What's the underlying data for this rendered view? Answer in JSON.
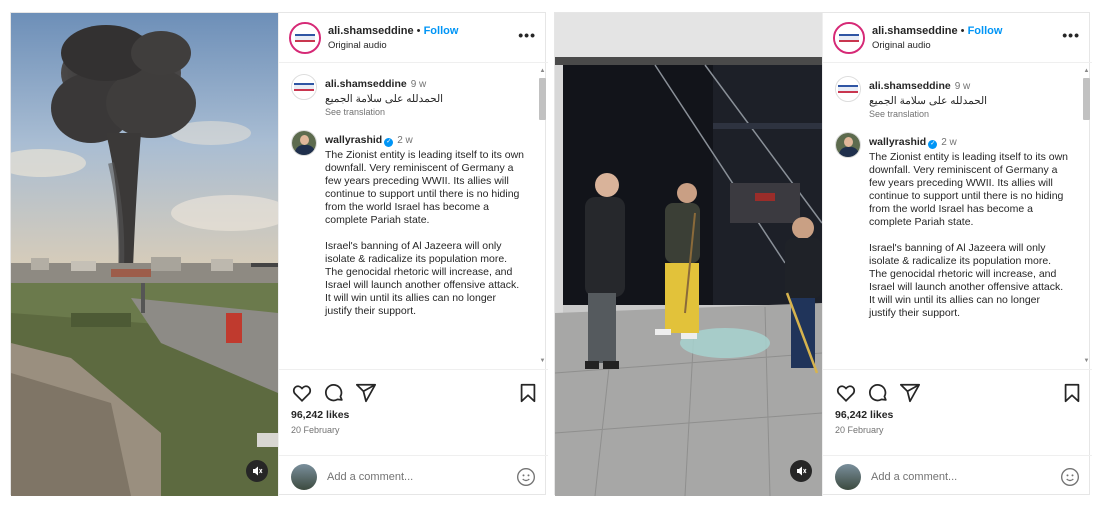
{
  "posts": [
    {
      "header": {
        "username": "ali.shamseddine",
        "separator": "•",
        "follow": "Follow",
        "audio": "Original audio",
        "more": "•••"
      },
      "comments": [
        {
          "user": "ali.shamseddine",
          "time": "9 w",
          "text": "الحمدلله على سلامة الجميع",
          "translate": "See translation"
        },
        {
          "user": "wallyrashid",
          "time": "2 w",
          "paragraph1": "The Zionist entity is leading itself to its own downfall. Very reminiscent of Germany a few years preceding WWII. Its allies will continue to support until there is no hiding from the world Israel has become a complete Pariah state.",
          "paragraph2": "Israel's banning of Al Jazeera will only isolate & radicalize its population more. The genocidal rhetoric will increase, and Israel will launch another offensive attack. It will win until its allies can no longer justify their support."
        }
      ],
      "likes": "96,242 likes",
      "date": "20 February",
      "comment_placeholder": "Add a comment...",
      "icons": [
        "heart-icon",
        "comment-icon",
        "share-icon",
        "bookmark-icon",
        "mute-icon",
        "emoji-icon"
      ]
    },
    {
      "header": {
        "username": "ali.shamseddine",
        "separator": "•",
        "follow": "Follow",
        "audio": "Original audio",
        "more": "•••"
      },
      "comments": [
        {
          "user": "ali.shamseddine",
          "time": "9 w",
          "text": "الحمدلله على سلامة الجميع",
          "translate": "See translation"
        },
        {
          "user": "wallyrashid",
          "time": "2 w",
          "paragraph1": "The Zionist entity is leading itself to its own downfall. Very reminiscent of Germany a few years preceding WWII. Its allies will continue to support until there is no hiding from the world Israel has become a complete Pariah state.",
          "paragraph2": "Israel's banning of Al Jazeera will only isolate & radicalize its population more. The genocidal rhetoric will increase, and Israel will launch another offensive attack. It will win until its allies can no longer justify their support."
        }
      ],
      "likes": "96,242 likes",
      "date": "20 February",
      "comment_placeholder": "Add a comment...",
      "icons": [
        "heart-icon",
        "comment-icon",
        "share-icon",
        "bookmark-icon",
        "mute-icon",
        "emoji-icon"
      ]
    }
  ],
  "colors": {
    "follow": "#0095f6",
    "text": "#262626",
    "muted": "#737373",
    "verified": "#0095f6",
    "avatar_ring": "#d62976"
  }
}
